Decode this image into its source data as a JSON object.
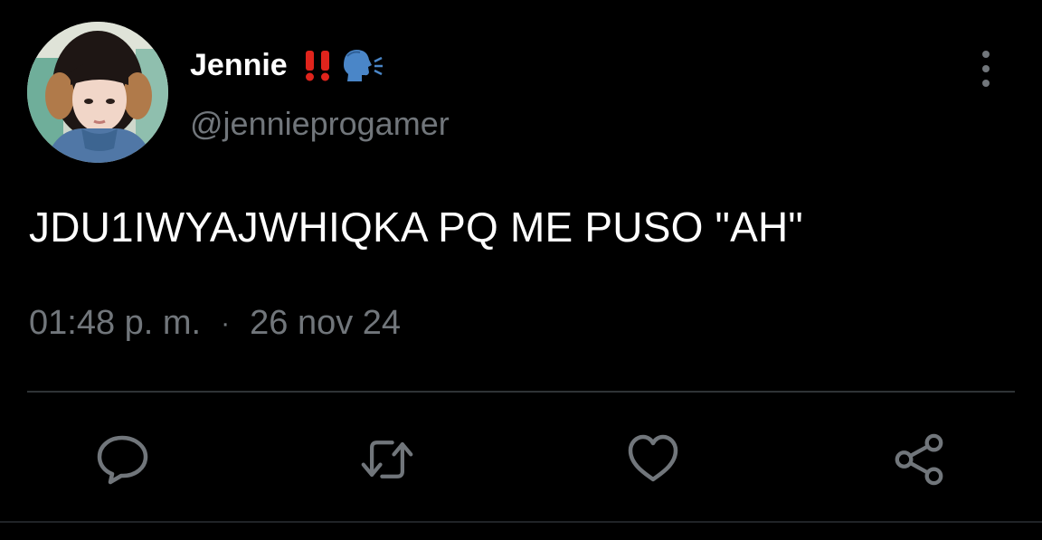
{
  "tweet": {
    "author": {
      "display_name": "Jennie",
      "handle": "@jennieprogamer"
    },
    "text": "JDU1IWYAJWHIQKA PQ ME PUSO \"AH\"",
    "time": "01:48 p. m.",
    "separator": "·",
    "date": "26 nov 24"
  },
  "actions": [
    {
      "icon": "reply-icon"
    },
    {
      "icon": "retweet-icon"
    },
    {
      "icon": "like-icon"
    },
    {
      "icon": "share-icon"
    }
  ],
  "colors": {
    "background": "#000000",
    "primary_text": "#ffffff",
    "secondary_text": "#71767b",
    "divider": "#2f3336",
    "emoji_red": "#e0241c",
    "emoji_blue": "#4a86c8"
  }
}
